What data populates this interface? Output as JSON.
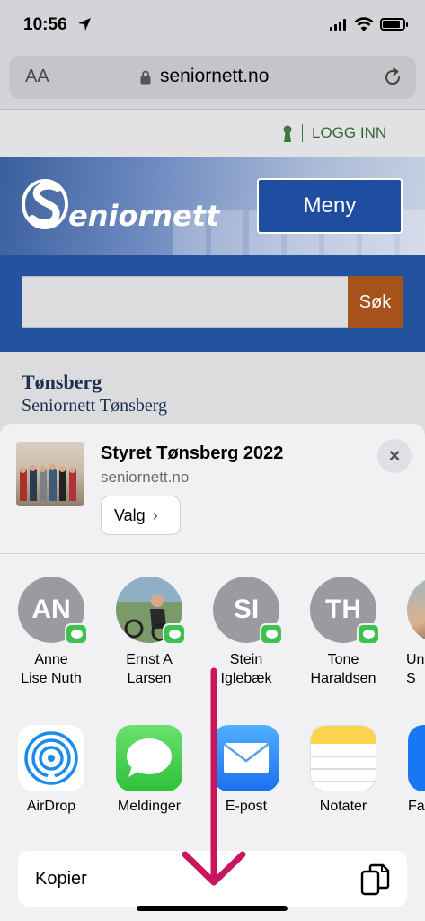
{
  "status_bar": {
    "time": "10:56"
  },
  "browser": {
    "text_size_label": "AA",
    "url": "seniornett.no"
  },
  "page": {
    "login_label": "LOGG INN",
    "logo_text": "eniornett",
    "menu_label": "Meny",
    "search_button_label": "Søk",
    "title": "Tønsberg",
    "subtitle": "Seniornett Tønsberg"
  },
  "share_sheet": {
    "title": "Styret Tønsberg 2022",
    "site": "seniornett.no",
    "options_label": "Valg",
    "close_label": "×",
    "people": [
      {
        "initials": "AN",
        "name_line1": "Anne",
        "name_line2": "Lise Nuth",
        "photo": false
      },
      {
        "initials": "",
        "name_line1": "Ernst A",
        "name_line2": "Larsen",
        "photo": true
      },
      {
        "initials": "SI",
        "name_line1": "Stein",
        "name_line2": "Iglebæk",
        "photo": false
      },
      {
        "initials": "TH",
        "name_line1": "Tone",
        "name_line2": "Haraldsen",
        "photo": false
      },
      {
        "initials": "",
        "name_line1": "Un",
        "name_line2": "S",
        "photo": true
      }
    ],
    "apps": [
      {
        "label": "AirDrop",
        "icon": "airdrop-icon"
      },
      {
        "label": "Meldinger",
        "icon": "messages-icon"
      },
      {
        "label": "E-post",
        "icon": "mail-icon"
      },
      {
        "label": "Notater",
        "icon": "notes-icon"
      },
      {
        "label": "Fac",
        "icon": "facebook-icon"
      }
    ],
    "copy_label": "Kopier"
  },
  "colors": {
    "brand_blue": "#23539f",
    "search_button": "#a6521b",
    "login_green": "#2f6b2f",
    "annotation_arrow": "#c8165e"
  }
}
